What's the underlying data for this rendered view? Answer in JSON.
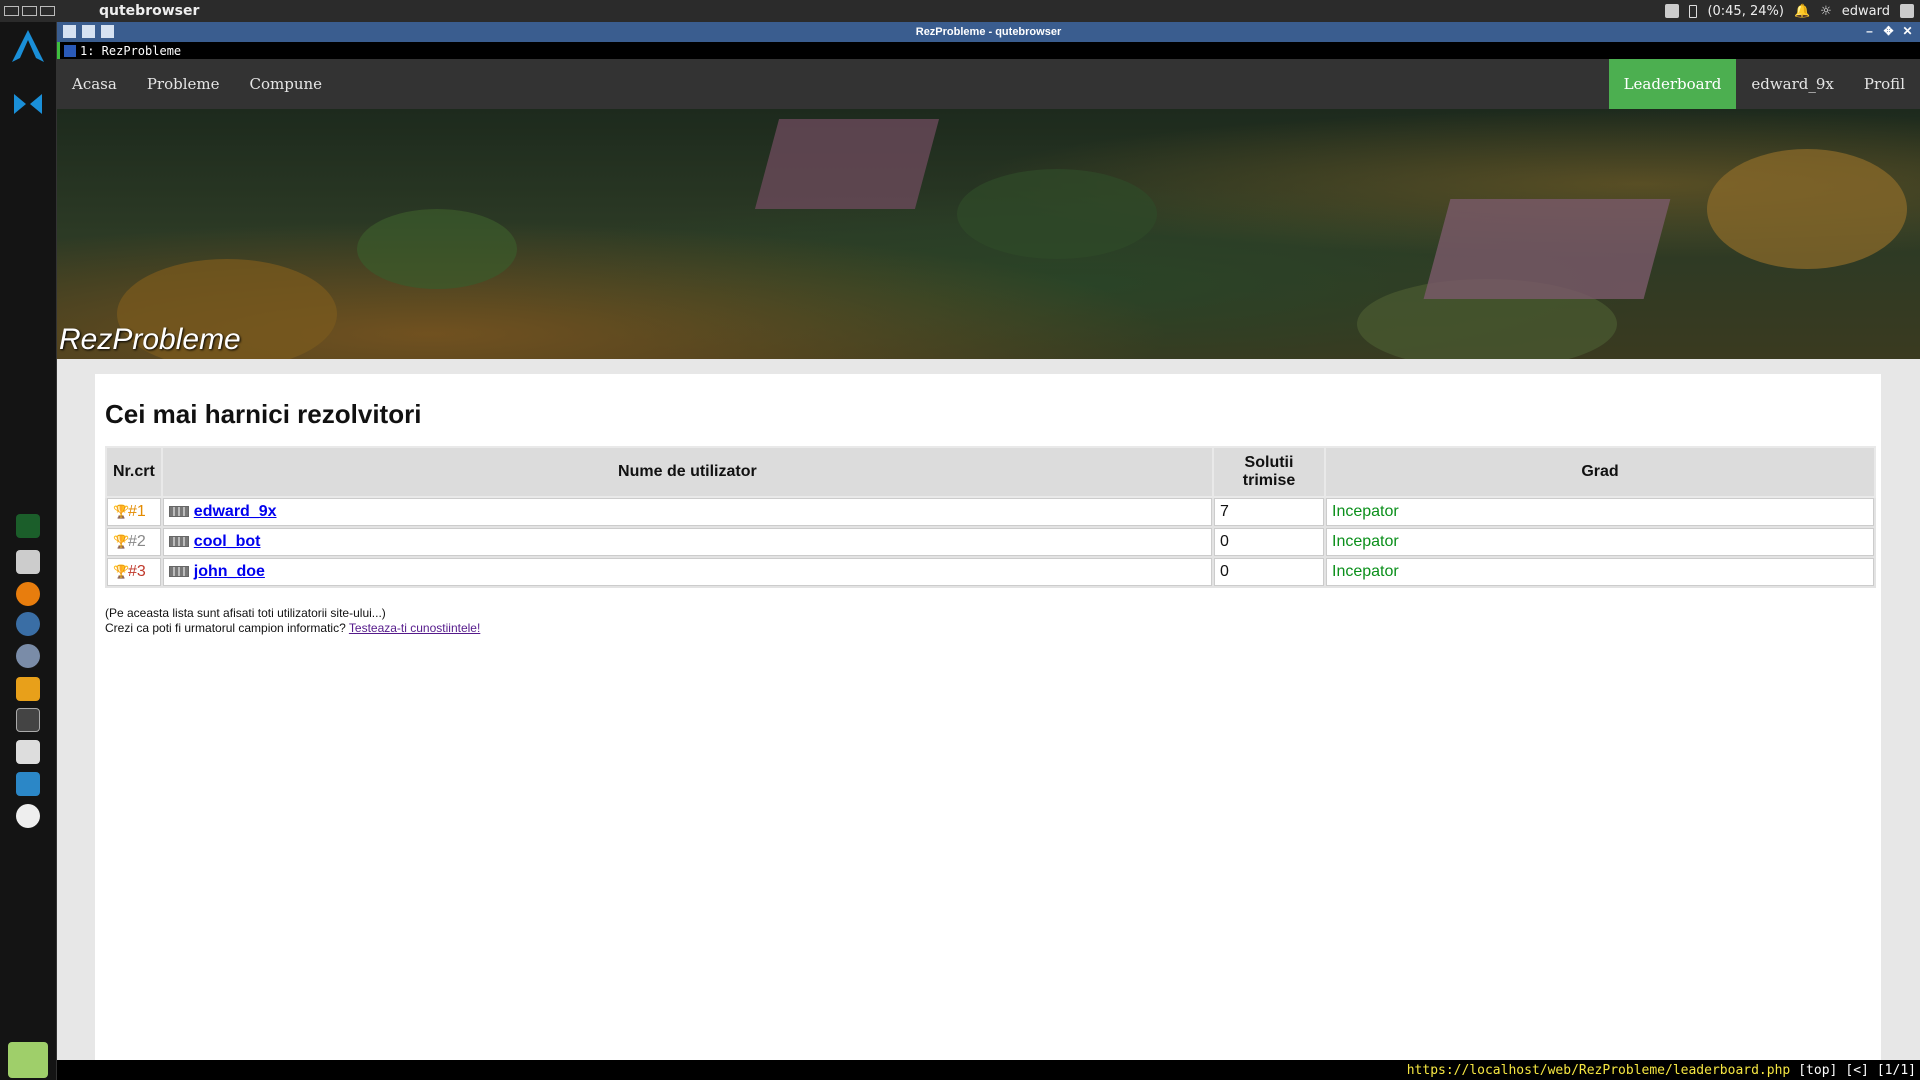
{
  "system_panel": {
    "app_name": "qutebrowser",
    "battery": "(0:45, 24%)",
    "user": "edward"
  },
  "window": {
    "title": "RezProbleme - qutebrowser",
    "tab_label": "1: RezProbleme"
  },
  "navbar": {
    "left_items": [
      "Acasa",
      "Probleme",
      "Compune"
    ],
    "right_items": [
      "Leaderboard",
      "edward_9x",
      "Profil"
    ],
    "active_item": "Leaderboard",
    "active_color": "#4caf50"
  },
  "hero": {
    "title": "RezProbleme"
  },
  "leaderboard": {
    "heading": "Cei mai harnici rezolvitori",
    "columns": [
      "Nr.crt",
      "Nume de utilizator",
      "Solutii trimise",
      "Grad"
    ],
    "rows": [
      {
        "rank": "#1",
        "username": "edward_9x",
        "solutions": "7",
        "grade": "Incepator"
      },
      {
        "rank": "#2",
        "username": "cool_bot",
        "solutions": "0",
        "grade": "Incepator"
      },
      {
        "rank": "#3",
        "username": "john_doe",
        "solutions": "0",
        "grade": "Incepator"
      }
    ],
    "note_line1": "(Pe aceasta lista sunt afisati toti utilizatorii site-ului...)",
    "note_line2_prefix": "Crezi ca poti fi urmatorul campion informatic?",
    "note_link": "Testeaza-ti cunostiintele!"
  },
  "statusbar": {
    "url": "https://localhost/web/RezProbleme/leaderboard.php",
    "position": "[top]",
    "history": "[<]",
    "tabs": "[1/1]"
  }
}
